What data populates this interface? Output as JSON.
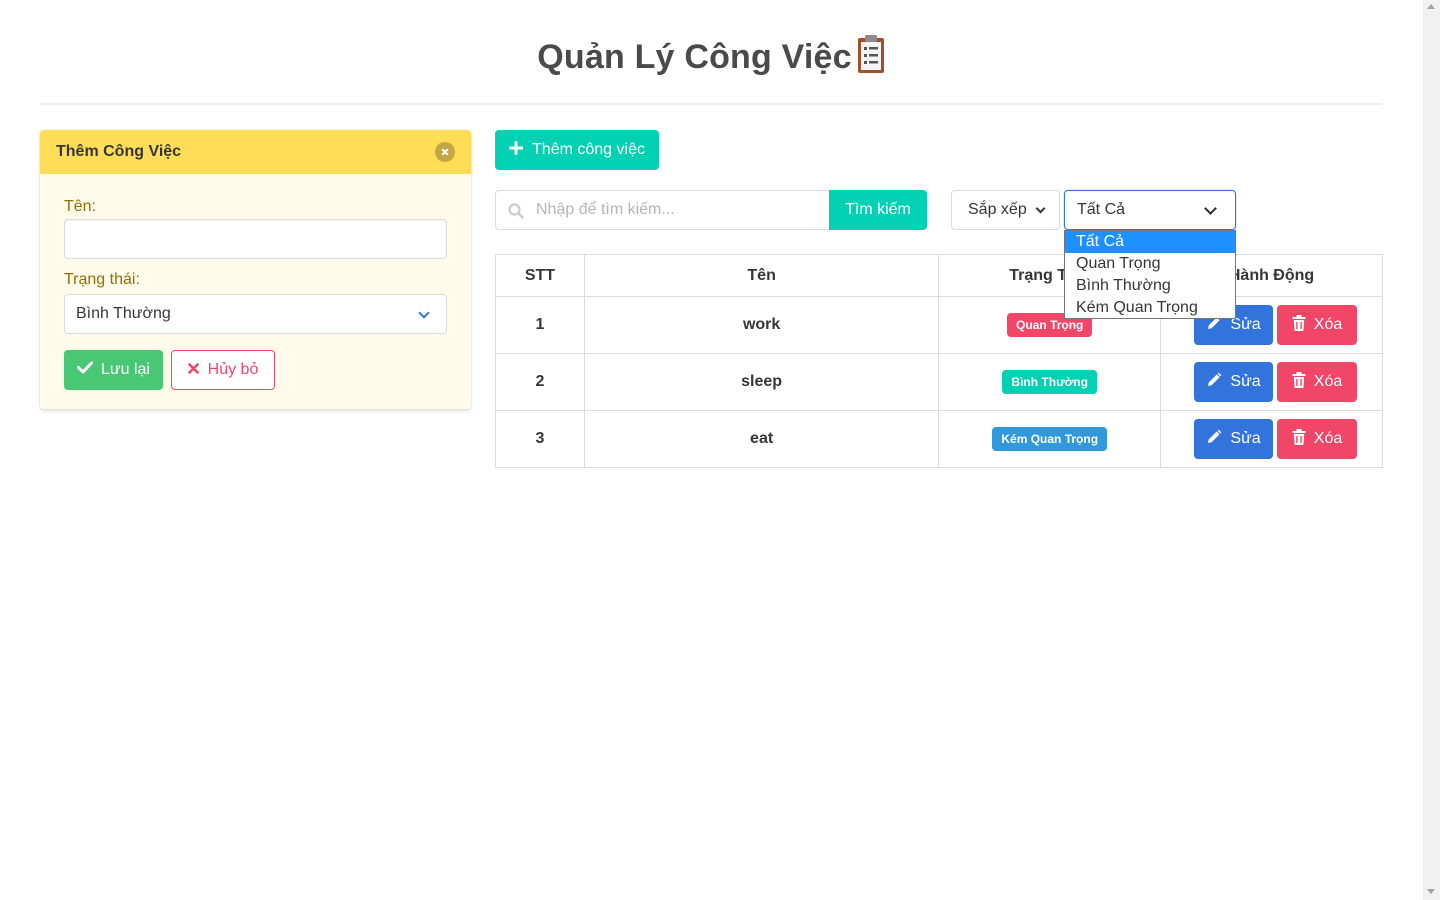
{
  "page": {
    "title": "Quản Lý Công Việc"
  },
  "form_panel": {
    "title": "Thêm Công Việc",
    "name_label": "Tên:",
    "name_value": "",
    "status_label": "Trạng thái:",
    "status_value": "Bình Thường",
    "save_label": "Lưu lại",
    "cancel_label": "Hủy bỏ"
  },
  "toolbar": {
    "add_label": "Thêm công việc",
    "search_placeholder": "Nhập để tìm kiếm...",
    "search_label": "Tìm kiếm",
    "sort_label": "Sắp xếp",
    "filter_value": "Tất Cả"
  },
  "filter_dropdown": {
    "options": [
      "Tất Cả",
      "Quan Trọng",
      "Bình Thường",
      "Kém Quan Trọng"
    ],
    "selected_index": 0
  },
  "table": {
    "headers": [
      "STT",
      "Tên",
      "Trạng Thái",
      "Hành Động"
    ],
    "rows": [
      {
        "stt": "1",
        "name": "work",
        "status": "Quan Trọng",
        "status_color": "#f14668",
        "edit": "Sửa",
        "delete": "Xóa"
      },
      {
        "stt": "2",
        "name": "sleep",
        "status": "Bình Thường",
        "status_color": "#00d1b2",
        "edit": "Sửa",
        "delete": "Xóa"
      },
      {
        "stt": "3",
        "name": "eat",
        "status": "Kém Quan Trọng",
        "status_color": "#3298dc",
        "edit": "Sửa",
        "delete": "Xóa"
      }
    ]
  },
  "colors": {
    "primary": "#00d1b2",
    "warning": "#ffdd57",
    "success": "#48c774",
    "danger": "#f14668",
    "link": "#3273dc",
    "info": "#3298dc"
  },
  "icons": {
    "title_icon": "clipboard-icon",
    "close": "close-icon",
    "save": "check-icon",
    "cancel": "times-icon",
    "add": "plus-icon",
    "search": "search-icon",
    "edit": "pencil-icon",
    "delete": "trash-icon",
    "dropdown": "chevron-down-icon"
  }
}
